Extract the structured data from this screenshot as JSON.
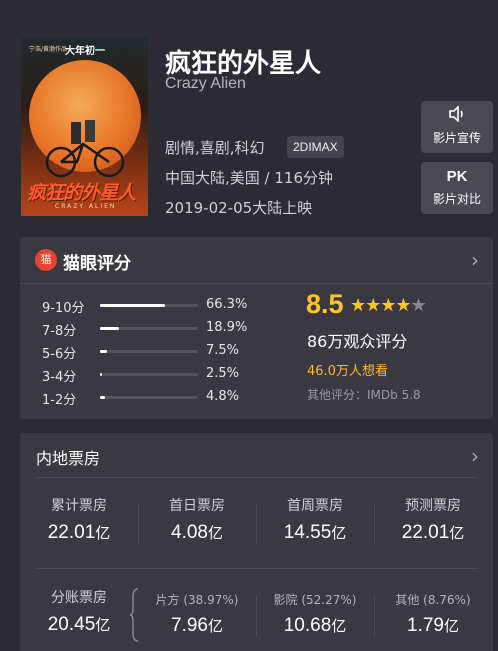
{
  "movie": {
    "title": "疯狂的外星人",
    "title_en": "Crazy Alien",
    "genres": "剧情,喜剧,科幻",
    "format": "2DIMAX",
    "region_duration": "中国大陆,美国 / 116分钟",
    "release": "2019-02-05大陆上映",
    "poster": {
      "top_text": "宁浩/黄渤作品",
      "release_tag": "大年初一",
      "title_art": "疯狂的外星人",
      "title_art_en": "CRAZY ALIEN"
    }
  },
  "side_buttons": {
    "trailer": {
      "icon": "speaker-icon",
      "label": "影片宣传"
    },
    "compare": {
      "icon_text": "PK",
      "label": "影片对比"
    }
  },
  "rating": {
    "section_title": "猫眼评分",
    "logo_glyph": "猫",
    "score": "8.5",
    "stars_full": "★★★★",
    "stars_half": "★",
    "star_level": 4.5,
    "voters": "86万观众评分",
    "wants": "46.0万人想看",
    "imdb": "其他评分：IMDb 5.8",
    "distribution": [
      {
        "label": "9-10分",
        "pct": "66.3%",
        "value": 66.3
      },
      {
        "label": "7-8分",
        "pct": "18.9%",
        "value": 18.9
      },
      {
        "label": "5-6分",
        "pct": "7.5%",
        "value": 7.5
      },
      {
        "label": "3-4分",
        "pct": "2.5%",
        "value": 2.5
      },
      {
        "label": "1-2分",
        "pct": "4.8%",
        "value": 4.8
      }
    ]
  },
  "box_office": {
    "section_title": "内地票房",
    "unit": "亿",
    "stats": [
      {
        "key": "累计票房",
        "value": "22.01"
      },
      {
        "key": "首日票房",
        "value": "4.08"
      },
      {
        "key": "首周票房",
        "value": "14.55"
      },
      {
        "key": "预测票房",
        "value": "22.01"
      }
    ],
    "split": {
      "key": "分账票房",
      "value": "20.45",
      "parts": [
        {
          "key": "片方 (38.97%)",
          "value": "7.96"
        },
        {
          "key": "影院 (52.27%)",
          "value": "10.68"
        },
        {
          "key": "其他 (8.76%)",
          "value": "1.79"
        }
      ]
    }
  },
  "colors": {
    "background": "#2c2b33",
    "card": "#3a3942",
    "accent_gold": "#ffc428",
    "wants_orange": "#ffb72a",
    "maoyan_red": "#e8452f"
  },
  "chevron": "›"
}
